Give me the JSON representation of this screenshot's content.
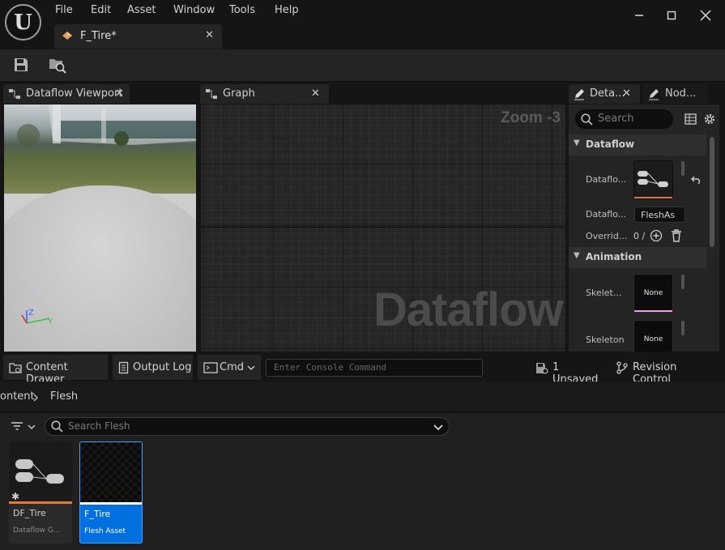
{
  "menu": [
    "File",
    "Edit",
    "Asset",
    "Window",
    "Tools",
    "Help"
  ],
  "asset_tab": {
    "label": "F_Tire*"
  },
  "panels": {
    "viewport_tab": "Dataflow Viewport",
    "graph_tab": "Graph",
    "details_tab": "Deta...",
    "node_tab": "Nod..."
  },
  "graph": {
    "zoom": "Zoom -3",
    "watermark": "Dataflow"
  },
  "viewport": {
    "axis_z": "Z",
    "axis_y": "Y"
  },
  "details": {
    "search_placeholder": "Search",
    "categories": [
      {
        "name": "Dataflow",
        "props": [
          {
            "label": "Dataflo...",
            "kind": "thumbnail"
          },
          {
            "label": "Dataflo...",
            "value": "FleshAs"
          },
          {
            "label": "Overrid...",
            "value": "0 /"
          }
        ]
      },
      {
        "name": "Animation",
        "props": [
          {
            "label": "Skelet...",
            "thumb_text": "None"
          },
          {
            "label": "Skeleton",
            "thumb_text": "None"
          }
        ]
      }
    ]
  },
  "statusbar": {
    "content_drawer": "Content Drawer",
    "output_log": "Output Log",
    "cmd": "Cmd",
    "console_placeholder": "Enter Console Command",
    "unsaved": "1 Unsaved",
    "revision_control": "Revision Control"
  },
  "drawer": {
    "breadcrumb": [
      "ontent",
      "Flesh"
    ],
    "search_placeholder": "Search Flesh",
    "assets": [
      {
        "name": "DF_Tire",
        "type": "Dataflow G...",
        "accent": "#e07b39",
        "selected": false
      },
      {
        "name": "F_Tire",
        "type": "Flesh Asset",
        "accent": "#ffffff",
        "selected": true
      }
    ]
  },
  "colors": {
    "selection_blue": "#0070e0",
    "dataflow_orange": "#e07b39",
    "skeleton_pink": "#e8a6e0"
  }
}
